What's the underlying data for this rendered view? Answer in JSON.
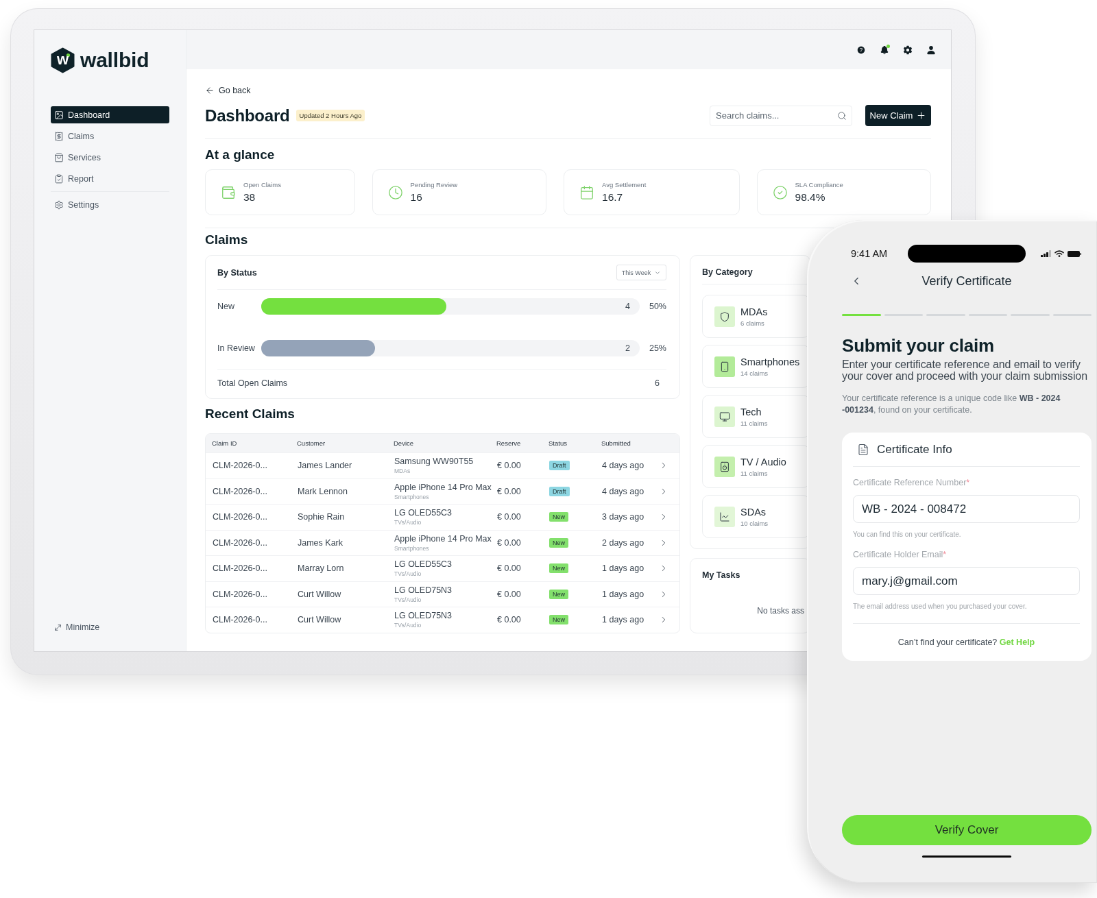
{
  "tablet": {
    "logo": {
      "mark": "w",
      "wordmark": "wallbid"
    },
    "sidebar": {
      "items": [
        {
          "label": "Dashboard",
          "selected": true
        },
        {
          "label": "Claims",
          "selected": false
        },
        {
          "label": "Services",
          "selected": false
        },
        {
          "label": "Report",
          "selected": false
        }
      ],
      "secondary_items": [
        {
          "label": "Settings",
          "selected": false
        }
      ],
      "minimize": "Minimize"
    },
    "top_bar": {
      "unread_notifications": true
    },
    "page": {
      "back_link": "Go back",
      "title": "Dashboard",
      "updated_badge": "Updated 2 Hours Ago",
      "search": {
        "placeholder": "Search claims..."
      },
      "new_claim_button": "New Claim"
    },
    "at_a_glance": {
      "title": "At a glance",
      "stats": [
        {
          "label": "Open Claims",
          "value": "38"
        },
        {
          "label": "Pending Review",
          "value": "16"
        },
        {
          "label": "Avg Settlement",
          "value": "16.7"
        },
        {
          "label": "SLA Compliance",
          "value": "98.4%"
        }
      ]
    },
    "claims": {
      "title": "Claims",
      "by_status": {
        "title": "By Status",
        "period": "This Week",
        "rows": [
          {
            "label": "New",
            "count": "4",
            "percent": "50%",
            "level": 0.49,
            "color": "#74e03f"
          },
          {
            "label": "In Review",
            "count": "2",
            "percent": "25%",
            "level": 0.3,
            "color": "#94a3b8"
          }
        ],
        "total_label": "Total Open Claims",
        "total": "6"
      },
      "by_category": {
        "title": "By Category",
        "items": [
          {
            "name": "MDAs",
            "count": "6 claims",
            "color": "#dcf5cf"
          },
          {
            "name": "Smartphones",
            "count": "14 claims",
            "color": "#b3eb99"
          },
          {
            "name": "Tech",
            "count": "11 claims",
            "color": "#dcf5cf"
          },
          {
            "name": "TV / Audio",
            "count": "11 claims",
            "color": "#c4efad"
          },
          {
            "name": "SDAs",
            "count": "10 claims",
            "color": "#e2f6d7"
          }
        ]
      },
      "my_tasks": {
        "title": "My Tasks",
        "empty_message": "No tasks ass"
      }
    },
    "recent_claims": {
      "title": "Recent Claims",
      "columns": [
        "Claim ID",
        "Customer",
        "Device",
        "Reserve",
        "Status",
        "Submitted"
      ],
      "rows": [
        {
          "claim_id": "CLM-2026-0...",
          "customer": "James Lander",
          "device": "Samsung WW90T55",
          "category": "MDAs",
          "reserve": "€ 0.00",
          "status": {
            "label": "Draft",
            "color": "#8dd6e2"
          },
          "submitted": "4 days ago"
        },
        {
          "claim_id": "CLM-2026-0...",
          "customer": "Mark Lennon",
          "device": "Apple iPhone 14 Pro Max",
          "category": "Smartphones",
          "reserve": "€ 0.00",
          "status": {
            "label": "Draft",
            "color": "#8dd6e2"
          },
          "submitted": "4 days ago"
        },
        {
          "claim_id": "CLM-2026-0...",
          "customer": "Sophie Rain",
          "device": "LG OLED55C3",
          "category": "TVs/Audio",
          "reserve": "€ 0.00",
          "status": {
            "label": "New",
            "color": "#83e06c"
          },
          "submitted": "3 days ago"
        },
        {
          "claim_id": "CLM-2026-0...",
          "customer": "James Kark",
          "device": "Apple iPhone 14 Pro Max",
          "category": "Smartphones",
          "reserve": "€ 0.00",
          "status": {
            "label": "New",
            "color": "#83e06c"
          },
          "submitted": "2 days ago"
        },
        {
          "claim_id": "CLM-2026-0...",
          "customer": "Marray Lorn",
          "device": "LG OLED55C3",
          "category": "TVs/Audio",
          "reserve": "€ 0.00",
          "status": {
            "label": "New",
            "color": "#83e06c"
          },
          "submitted": "1 days ago"
        },
        {
          "claim_id": "CLM-2026-0...",
          "customer": "Curt Willow",
          "device": "LG OLED75N3",
          "category": "TVs/Audio",
          "reserve": "€ 0.00",
          "status": {
            "label": "New",
            "color": "#83e06c"
          },
          "submitted": "1 days ago"
        },
        {
          "claim_id": "CLM-2026-0...",
          "customer": "Curt Willow",
          "device": "LG OLED75N3",
          "category": "TVs/Audio",
          "reserve": "€ 0.00",
          "status": {
            "label": "New",
            "color": "#83e06c"
          },
          "submitted": "1 days ago"
        }
      ]
    }
  },
  "phone": {
    "status_bar": {
      "time": "9:41 AM"
    },
    "nav": {
      "title": "Verify Certificate"
    },
    "progress_steps": [
      {
        "completed": true
      },
      {
        "completed": false
      },
      {
        "completed": false
      },
      {
        "completed": false
      },
      {
        "completed": false
      },
      {
        "completed": false
      }
    ],
    "heading": "Submit your claim",
    "intro": "Enter your certificate reference and email to verify your cover and proceed with your claim submission",
    "hint": "Your certificate reference is a unique code like **WB - 2024 -001234**, found on your certificate.",
    "card": {
      "title": "Certificate Info",
      "fields": [
        {
          "label": "Certificate Reference Number",
          "required_mark": "*",
          "value": "WB - 2024 - 008472",
          "help": "You can find this on your certificate."
        },
        {
          "label": "Certificate Holder Email",
          "required_mark": "*",
          "value": "mary.j@gmail.com",
          "help": "The email address used when you purchased your cover."
        }
      ],
      "footer_text": "Can’t find your certificate?",
      "footer_link": "Get Help"
    },
    "submit_button": "Verify Cover"
  }
}
